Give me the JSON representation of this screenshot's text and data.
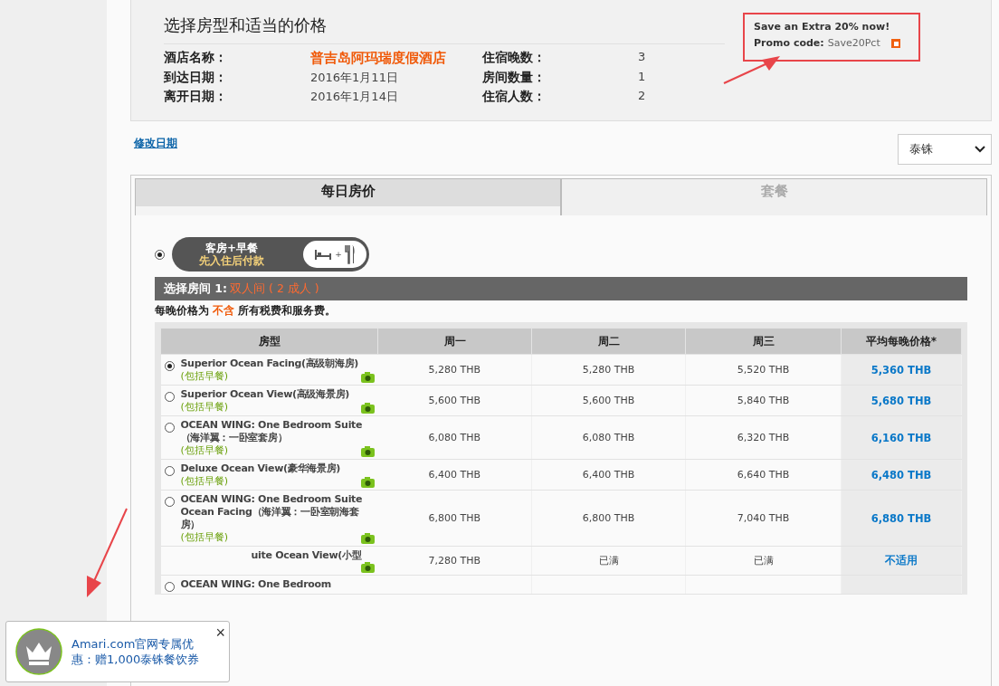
{
  "summary": {
    "title": "选择房型和适当的价格",
    "left": [
      {
        "label": "酒店名称：",
        "value": "普吉岛阿玛瑞度假酒店",
        "highlight": true
      },
      {
        "label": "到达日期：",
        "value": "2016年1月11日",
        "highlight": false
      },
      {
        "label": "离开日期：",
        "value": "2016年1月14日",
        "highlight": false
      }
    ],
    "right": [
      {
        "label": "住宿晚数：",
        "value": "3"
      },
      {
        "label": "房间数量：",
        "value": "1"
      },
      {
        "label": "住宿人数：",
        "value": "2"
      }
    ]
  },
  "promo": {
    "headline": "Save an Extra 20% now!",
    "code_label": "Promo code:",
    "code": "Save20Pct"
  },
  "change_dates_link": "修改日期",
  "currency_select": {
    "value": "泰铢"
  },
  "tabs": [
    {
      "label": "每日房价",
      "selected": true
    },
    {
      "label": "套餐",
      "selected": false
    }
  ],
  "package": {
    "selected": true,
    "line1": "客房+早餐",
    "line2": "先入住后付款",
    "plus": "+"
  },
  "room_bar": {
    "label": "选择房间 1:",
    "value": "双人间 ( 2 成人 )"
  },
  "tax_note": {
    "before": "每晚价格为",
    "highlight": "不含",
    "after": "所有税费和服务费。"
  },
  "table": {
    "columns": [
      "房型",
      "周一",
      "周二",
      "周三",
      "平均每晚价格*"
    ],
    "rows": [
      {
        "kind": "radio",
        "selected": true,
        "name": "Superior Ocean Facing(高级朝海房)",
        "note": "(包括早餐)",
        "prices": [
          "5,280 THB",
          "5,280 THB",
          "5,520 THB"
        ],
        "average": "5,360 THB"
      },
      {
        "kind": "radio",
        "selected": false,
        "name": "Superior Ocean View(高级海景房)",
        "note": "(包括早餐)",
        "prices": [
          "5,600 THB",
          "5,600 THB",
          "5,840 THB"
        ],
        "average": "5,680 THB"
      },
      {
        "kind": "radio",
        "selected": false,
        "name": "OCEAN WING: One Bedroom Suite（海洋翼：一卧室套房）",
        "note": "(包括早餐)",
        "prices": [
          "6,080 THB",
          "6,080 THB",
          "6,320 THB"
        ],
        "average": "6,160 THB"
      },
      {
        "kind": "radio",
        "selected": false,
        "name": "Deluxe Ocean View(豪华海景房)",
        "note": "(包括早餐)",
        "prices": [
          "6,400 THB",
          "6,400 THB",
          "6,640 THB"
        ],
        "average": "6,480 THB"
      },
      {
        "kind": "radio",
        "selected": false,
        "name": "OCEAN WING: One Bedroom Suite Ocean Facing（海洋翼：一卧室朝海套房）",
        "note": "(包括早餐)",
        "prices": [
          "6,800 THB",
          "6,800 THB",
          "7,040 THB"
        ],
        "average": "6,880 THB"
      },
      {
        "kind": "covered",
        "name": "uite Ocean View(小型",
        "prices": [
          "7,280 THB",
          "已满",
          "已满"
        ],
        "average": "不适用"
      },
      {
        "kind": "radio",
        "selected": false,
        "name": "OCEAN WING: One Bedroom"
      }
    ]
  },
  "popup": {
    "text": "Amari.com官网专属优惠：赠1,000泰铢餐饮券",
    "close": "×"
  }
}
